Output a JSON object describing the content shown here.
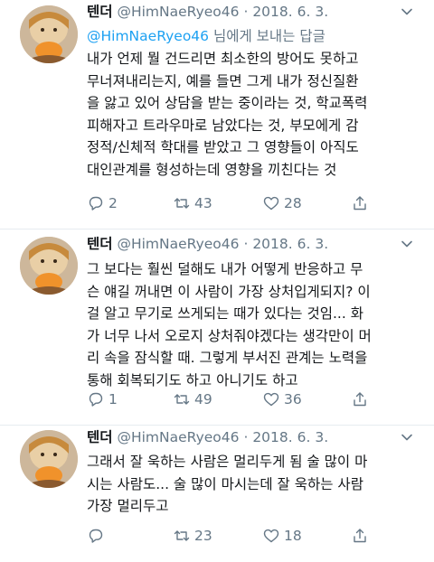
{
  "colors": {
    "link": "#1da1f2",
    "meta": "#657786",
    "text": "#14171a"
  },
  "tweets": [
    {
      "name": "텐더",
      "handle": "@HimNaeRyeo46",
      "separator": "·",
      "date": "2018. 6. 3.",
      "reply_mention": "@HimNaeRyeo46",
      "reply_suffix": " 님에게 보내는 답글",
      "lines": [
        "내가 언제 뭘 건드리면 최소한의 방어도 못하고",
        "무너져내리는지, 예를 들면 그게 내가 정신질환",
        "을 앓고 있어 상담을 받는 중이라는 것, 학교폭력",
        "피해자고 트라우마로 남았다는 것, 부모에게 감",
        "정적/신체적 학대를 받았고 그 영향들이 아직도",
        "대인관계를 형성하는데 영향을 끼친다는 것"
      ],
      "replies": "2",
      "retweets": "43",
      "likes": "28"
    },
    {
      "name": "텐더",
      "handle": "@HimNaeRyeo46",
      "separator": "·",
      "date": "2018. 6. 3.",
      "lines": [
        "그 보다는 훨씬 덜해도 내가 어떻게 반응하고 무",
        "슨 얘길 꺼내면 이 사람이 가장 상처입게되지? 이",
        "걸 알고 무기로 쓰게되는 때가 있다는 것임... 화",
        "가 너무 나서 오로지 상처줘야겠다는 생각만이 머",
        "리 속을 잠식할 때. 그렇게 부서진 관계는 노력을",
        "통해 회복되기도 하고 아니기도 하고"
      ],
      "replies": "1",
      "retweets": "49",
      "likes": "36"
    },
    {
      "name": "텐더",
      "handle": "@HimNaeRyeo46",
      "separator": "·",
      "date": "2018. 6. 3.",
      "lines": [
        "그래서 잘 욱하는 사람은 멀리두게 됨 술 많이 마",
        "시는 사람도... 술 많이 마시는데 잘 욱하는 사람",
        "가장 멀리두고"
      ],
      "replies": "",
      "retweets": "23",
      "likes": "18"
    }
  ]
}
